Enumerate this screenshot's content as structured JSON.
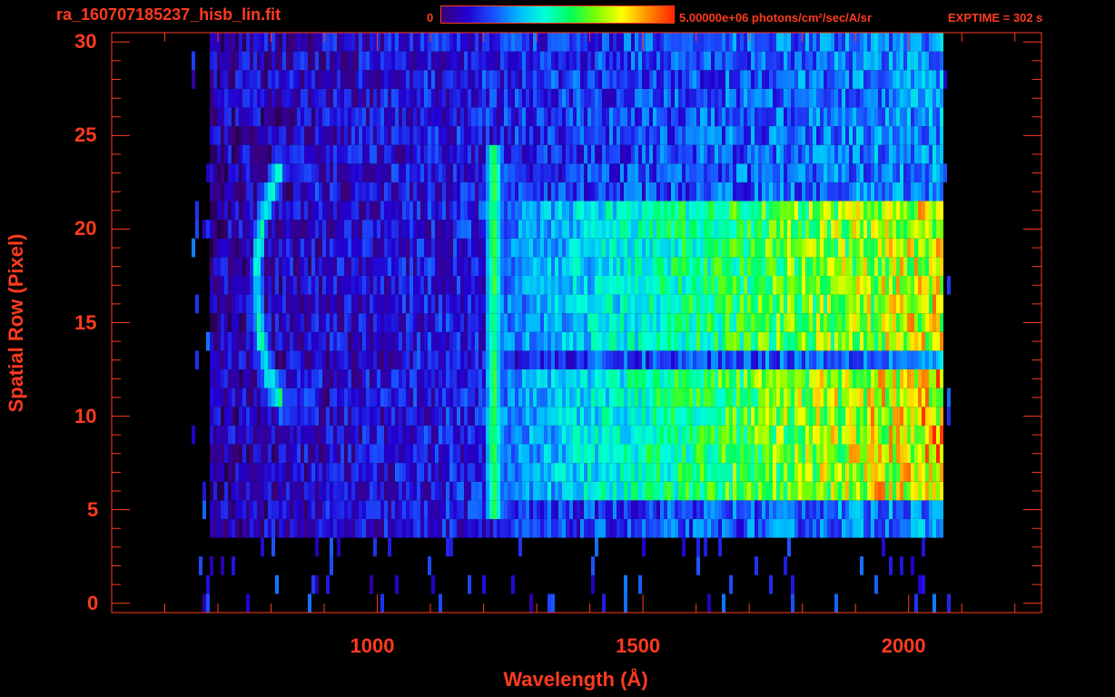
{
  "header": {
    "file_title": "ra_160707185237_hisb_lin.fit",
    "colorbar_min": "0",
    "colorbar_max": "5.00000e+06 photons/cm²/sec/A/sr",
    "exptime": "EXPTIME = 302 s"
  },
  "colors": {
    "axis": "#ff3b1f",
    "background": "#000000",
    "colormap": [
      "#000000",
      "#3a0078",
      "#2200d0",
      "#1b4dff",
      "#00b8ff",
      "#00ffd8",
      "#00ff5a",
      "#7cff00",
      "#ffff00",
      "#ff8c00",
      "#ff2400"
    ]
  },
  "chart_data": {
    "type": "heatmap",
    "title": "",
    "xlabel": "Wavelength (Å)",
    "ylabel": "Spatial Row (Pixel)",
    "xlim": [
      500,
      2250
    ],
    "ylim": [
      -0.5,
      30.5
    ],
    "x_ticks": [
      1000,
      1500,
      2000
    ],
    "y_ticks": [
      0,
      5,
      10,
      15,
      20,
      25,
      30
    ],
    "colorbar_range": [
      0,
      5000000
    ],
    "rows": 31,
    "features": [
      {
        "name": "ring_left",
        "x_center": 840,
        "y_center": 17,
        "x_radius": 70,
        "y_radius": 6.5,
        "level": 0.55
      },
      {
        "name": "lyman_alpha_line",
        "x_center": 1216,
        "y_range": [
          5,
          24
        ],
        "level": 0.65
      },
      {
        "name": "continuum_upper",
        "x_range": [
          1200,
          2060
        ],
        "y_range": [
          14,
          21
        ],
        "level_start": 0.3,
        "level_end": 0.8
      },
      {
        "name": "continuum_lower",
        "x_range": [
          1200,
          2060
        ],
        "y_range": [
          6,
          12
        ],
        "level_start": 0.3,
        "level_end": 0.85
      },
      {
        "name": "background_noise",
        "x_range": [
          680,
          2060
        ],
        "y_range": [
          4,
          30
        ],
        "level": 0.18
      }
    ]
  }
}
